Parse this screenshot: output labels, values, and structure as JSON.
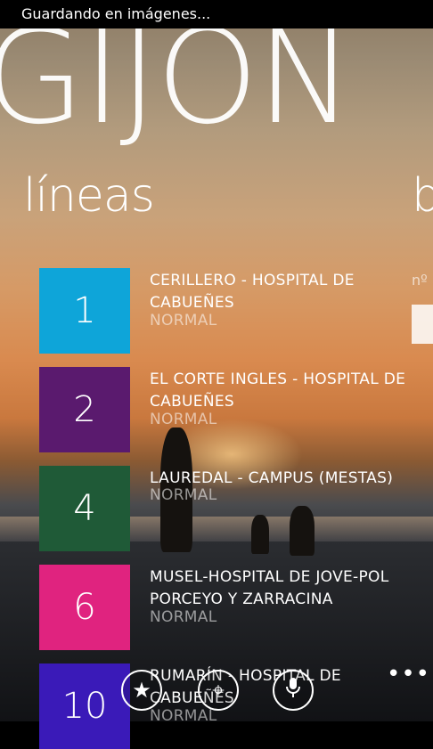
{
  "status": {
    "text": "Guardando en imágenes..."
  },
  "app": {
    "title": "GIJON"
  },
  "sections": {
    "current": "líneas",
    "next": "b",
    "next_label": "nº"
  },
  "lines": [
    {
      "number": "1",
      "name": "CERILLERO - HOSPITAL DE CABUEÑES",
      "type": "NORMAL",
      "color": "#0ea5d9"
    },
    {
      "number": "2",
      "name": "EL CORTE INGLES - HOSPITAL DE CABUEÑES",
      "type": "NORMAL",
      "color": "#5a1a6e"
    },
    {
      "number": "4",
      "name": "LAUREDAL - CAMPUS (MESTAS)",
      "type": "NORMAL",
      "color": "#1f5a37"
    },
    {
      "number": "6",
      "name": "MUSEL-HOSPITAL DE JOVE-POL PORCEYO Y ZARRACINA",
      "type": "NORMAL",
      "color": "#e0237f"
    },
    {
      "number": "10",
      "name": "RUMARÍN - HOSPITAL DE CABUEÑES",
      "type": "NORMAL",
      "color": "#3a1ab8"
    }
  ],
  "appbar": {
    "buttons": [
      {
        "icon": "star-icon",
        "glyph": "★"
      },
      {
        "icon": "locate-icon",
        "glyph": "⌖"
      },
      {
        "icon": "microphone-icon",
        "glyph": "🎙"
      }
    ],
    "more": "•••"
  }
}
